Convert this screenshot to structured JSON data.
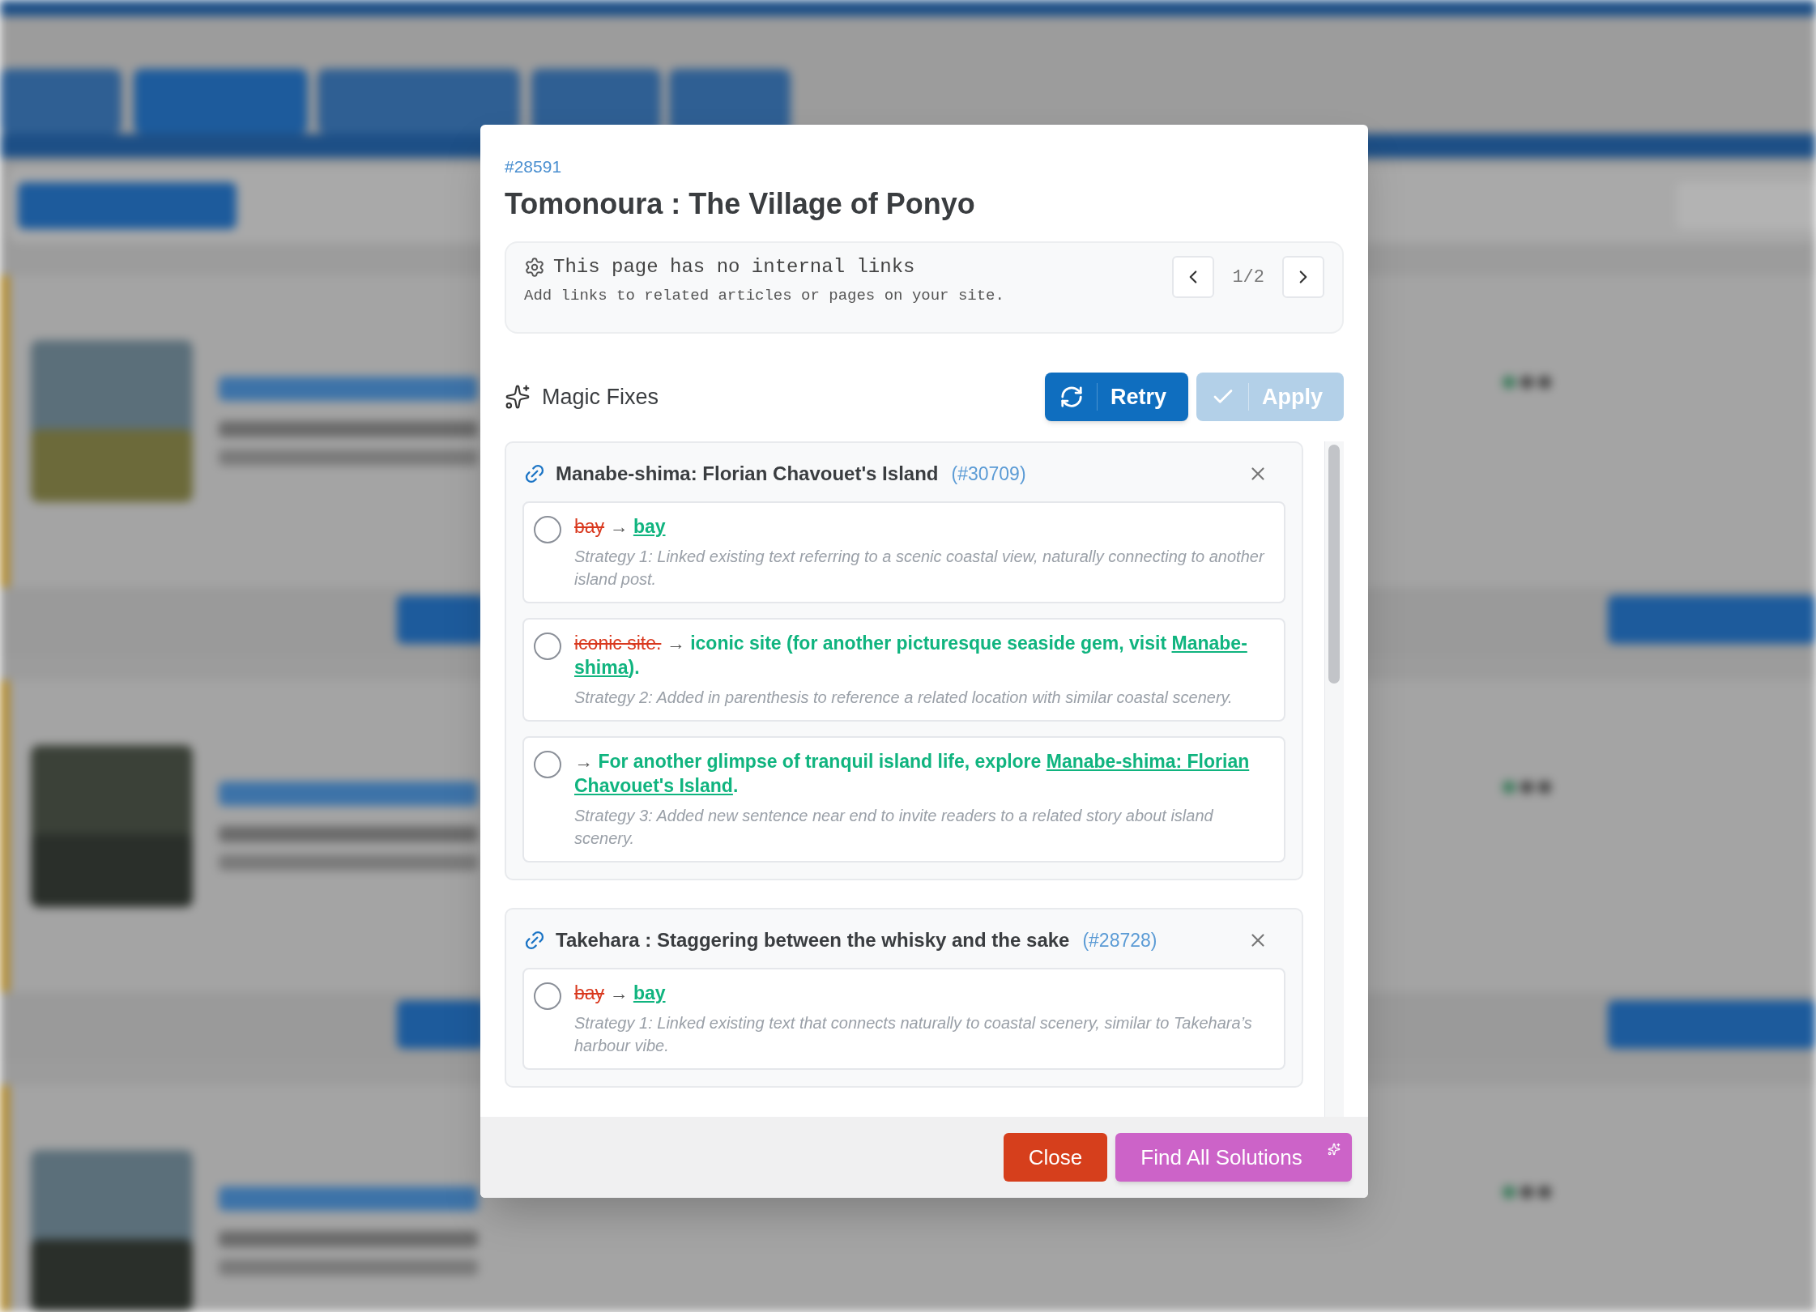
{
  "dialog": {
    "post_id": "#28591",
    "title": "Tomonoura : The Village of Ponyo",
    "notice": {
      "heading": "This page has no internal links",
      "detail": "Add links to related articles or pages on your site.",
      "page": "1/2"
    },
    "section_title": "Magic Fixes",
    "actions": [
      {
        "label": "Retry",
        "kind": "retry",
        "disabled": false
      },
      {
        "label": "Apply",
        "kind": "apply",
        "disabled": true
      }
    ],
    "groups": [
      {
        "title": "Manabe-shima: Florian Chavouet's Island",
        "post_id": "(#30709)",
        "options": [
          {
            "selected": false,
            "removed": "bay",
            "arrow": "→",
            "added": [
              {
                "kind": "link",
                "text": "bay"
              }
            ],
            "strategy": "Strategy 1: Linked existing text referring to a scenic coastal view, naturally connecting to another island post."
          },
          {
            "selected": false,
            "removed": "iconic site.",
            "arrow": "→",
            "added": [
              {
                "kind": "text",
                "text": "iconic site (for another picturesque seaside gem, visit "
              },
              {
                "kind": "link",
                "text": "Manabe-shima"
              },
              {
                "kind": "text",
                "text": ")."
              }
            ],
            "strategy": "Strategy 2: Added in parenthesis to reference a related location with similar coastal scenery."
          },
          {
            "selected": false,
            "arrow": "→",
            "added": [
              {
                "kind": "text",
                "text": "For another glimpse of tranquil island life, explore "
              },
              {
                "kind": "link",
                "text": "Manabe-shima: Florian Chavouet's Island"
              },
              {
                "kind": "text",
                "text": "."
              }
            ],
            "strategy": "Strategy 3: Added new sentence near end to invite readers to a related story about island scenery."
          }
        ]
      },
      {
        "title": "Takehara : Staggering between the whisky and the sake",
        "post_id": "(#28728)",
        "options": [
          {
            "selected": false,
            "removed": "bay",
            "arrow": "→",
            "added": [
              {
                "kind": "link",
                "text": "bay"
              }
            ],
            "strategy": "Strategy 1: Linked existing text that connects naturally to coastal scenery, similar to Takehara’s harbour vibe."
          }
        ]
      }
    ],
    "footer": [
      {
        "label": "Close",
        "kind": "close"
      },
      {
        "label": "Find All Solutions",
        "kind": "find"
      }
    ]
  }
}
